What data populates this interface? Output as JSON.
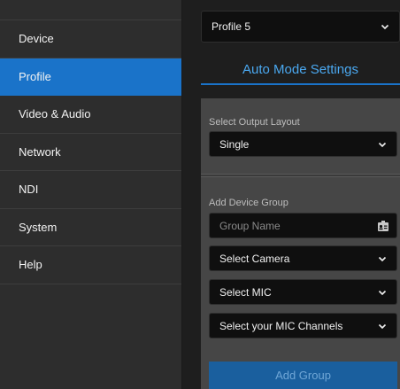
{
  "sidebar": {
    "items": [
      {
        "label": "Device",
        "active": false
      },
      {
        "label": "Profile",
        "active": true
      },
      {
        "label": "Video & Audio",
        "active": false
      },
      {
        "label": "Network",
        "active": false
      },
      {
        "label": "NDI",
        "active": false
      },
      {
        "label": "System",
        "active": false
      },
      {
        "label": "Help",
        "active": false
      }
    ]
  },
  "main": {
    "profile_select": {
      "value": "Profile 5",
      "icon": "chevron-down-icon"
    },
    "tab_heading": "Auto Mode Settings",
    "output_layout": {
      "label": "Select Output Layout",
      "value": "Single"
    },
    "device_group": {
      "label": "Add Device Group",
      "group_name_placeholder": "Group Name",
      "group_name_icon": "id-badge-icon",
      "camera_select": "Select Camera",
      "mic_select": "Select MIC",
      "mic_channels_select": "Select your MIC Channels",
      "add_button": "Add Group"
    }
  },
  "colors": {
    "accent": "#1a73c9",
    "heading": "#4aa8f0",
    "sidebar_bg": "#2d2d2d",
    "panel_bg": "#464646",
    "field_bg": "#0f0f0f"
  }
}
